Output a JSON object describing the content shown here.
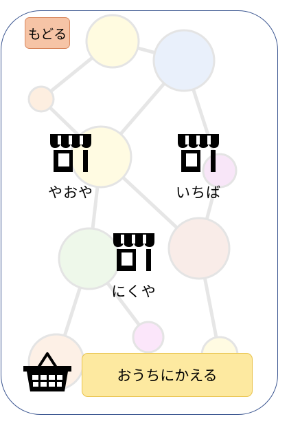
{
  "header": {
    "back_label": "もどる"
  },
  "shops": [
    {
      "label": "やおや",
      "icon": "shop-icon"
    },
    {
      "label": "いちば",
      "icon": "shop-icon"
    },
    {
      "label": "にくや",
      "icon": "shop-icon"
    }
  ],
  "footer": {
    "basket_icon": "basket-icon",
    "home_label": "おうちにかえる"
  },
  "colors": {
    "back_button": "#f6c4a6",
    "home_button": "#fde9a0",
    "frame_border": "#3a5590"
  }
}
